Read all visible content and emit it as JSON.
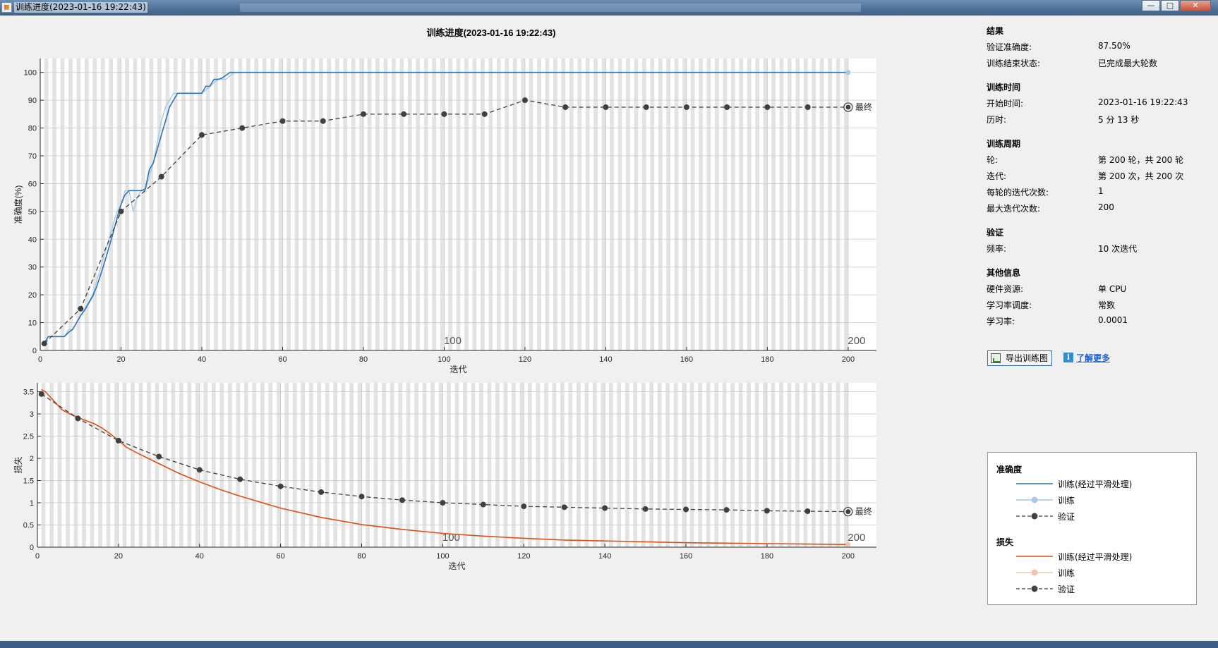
{
  "window": {
    "title": "训练进度(2023-01-16 19:22:43)",
    "btn_min": "—",
    "btn_max": "□",
    "btn_close": "✕"
  },
  "chart_title": "训练进度(2023-01-16 19:22:43)",
  "chart_data": [
    {
      "type": "line",
      "name": "accuracy",
      "xlabel": "迭代",
      "ylabel": "准确度(%)",
      "xlim": [
        0,
        200
      ],
      "ylim": [
        0,
        105
      ],
      "xticks": [
        0,
        20,
        40,
        60,
        80,
        100,
        120,
        140,
        160,
        180,
        200
      ],
      "yticks": [
        0,
        10,
        20,
        30,
        40,
        50,
        60,
        70,
        80,
        90,
        100
      ],
      "epoch_markers": [
        "100",
        "200"
      ],
      "grid": true,
      "colors": {
        "smooth": "#2f74b5",
        "raw": "#a9c9e6",
        "validation": "#404040"
      },
      "series": [
        {
          "name": "训练(经过平滑处理)",
          "x": [
            1,
            2,
            3,
            4,
            5,
            6,
            7,
            8,
            9,
            10,
            11,
            12,
            13,
            14,
            15,
            16,
            17,
            18,
            19,
            20,
            21,
            22,
            23,
            24,
            25,
            26,
            27,
            28,
            29,
            30,
            31,
            32,
            33,
            34,
            35,
            36,
            37,
            38,
            39,
            40,
            41,
            42,
            43,
            44,
            45,
            46,
            47,
            48,
            60,
            80,
            100,
            120,
            140,
            160,
            180,
            200
          ],
          "y": [
            2.5,
            5,
            5,
            5,
            5,
            5,
            6.5,
            7.5,
            10,
            12.5,
            14.5,
            17,
            19.5,
            23,
            27.5,
            32,
            37,
            42,
            47.5,
            52.5,
            56,
            57.5,
            57.5,
            57.5,
            57.5,
            58,
            65,
            67.5,
            72.5,
            77.5,
            82.5,
            87.5,
            90,
            92.5,
            92.5,
            92.5,
            92.5,
            92.5,
            92.5,
            92.5,
            95,
            95,
            97.5,
            97.5,
            98,
            99,
            100,
            100,
            100,
            100,
            100,
            100,
            100,
            100,
            100,
            100
          ]
        },
        {
          "name": "训练",
          "x": [
            1,
            2,
            3,
            4,
            5,
            6,
            7,
            8,
            9,
            10,
            11,
            12,
            13,
            14,
            15,
            16,
            17,
            18,
            19,
            20,
            21,
            22,
            23,
            24,
            25,
            26,
            27,
            28,
            29,
            30,
            31,
            32,
            33,
            34,
            35,
            36,
            37,
            38,
            39,
            40,
            42,
            44,
            46,
            48,
            60,
            80,
            100,
            120,
            140,
            160,
            180,
            200
          ],
          "y": [
            2.5,
            5,
            5,
            5,
            5,
            5,
            7.5,
            7.5,
            10,
            12.5,
            15,
            17.5,
            20,
            25,
            30,
            35,
            40,
            45,
            50,
            52.5,
            57.5,
            57.5,
            50,
            55,
            57.5,
            57.5,
            62.5,
            67.5,
            75,
            82.5,
            87.5,
            90,
            92.5,
            92.5,
            92.5,
            92.5,
            92.5,
            92.5,
            92.5,
            92.5,
            95,
            97.5,
            97.5,
            100,
            100,
            100,
            100,
            100,
            100,
            100,
            100,
            100
          ]
        },
        {
          "name": "验证",
          "x": [
            1,
            10,
            20,
            30,
            40,
            50,
            60,
            70,
            80,
            90,
            100,
            110,
            120,
            130,
            140,
            150,
            160,
            170,
            180,
            190,
            200
          ],
          "y": [
            2.5,
            15,
            50,
            62.5,
            77.5,
            80,
            82.5,
            82.5,
            85,
            85,
            85,
            85,
            90,
            87.5,
            87.5,
            87.5,
            87.5,
            87.5,
            87.5,
            87.5,
            87.5
          ]
        }
      ],
      "final_label": "最终"
    },
    {
      "type": "line",
      "name": "loss",
      "xlabel": "迭代",
      "ylabel": "损失",
      "xlim": [
        0,
        200
      ],
      "ylim": [
        0,
        3.7
      ],
      "xticks": [
        0,
        20,
        40,
        60,
        80,
        100,
        120,
        140,
        160,
        180,
        200
      ],
      "yticks": [
        0,
        0.5,
        1,
        1.5,
        2,
        2.5,
        3,
        3.5
      ],
      "epoch_markers": [
        "100",
        "200"
      ],
      "grid": true,
      "colors": {
        "smooth": "#d95319",
        "raw": "#f2c4ad",
        "validation": "#404040"
      },
      "series": [
        {
          "name": "训练(经过平滑处理)",
          "x": [
            1,
            2,
            3,
            4,
            5,
            6,
            8,
            10,
            12,
            14,
            16,
            18,
            20,
            22,
            24,
            26,
            28,
            30,
            35,
            40,
            45,
            50,
            60,
            70,
            80,
            90,
            100,
            110,
            120,
            130,
            140,
            150,
            160,
            170,
            180,
            190,
            200
          ],
          "y": [
            3.55,
            3.5,
            3.4,
            3.3,
            3.2,
            3.1,
            3.0,
            2.92,
            2.85,
            2.78,
            2.68,
            2.55,
            2.4,
            2.25,
            2.15,
            2.06,
            1.97,
            1.88,
            1.66,
            1.47,
            1.3,
            1.15,
            0.88,
            0.67,
            0.51,
            0.4,
            0.31,
            0.25,
            0.2,
            0.16,
            0.14,
            0.12,
            0.1,
            0.09,
            0.08,
            0.07,
            0.06
          ]
        },
        {
          "name": "训练",
          "x": [
            1,
            2,
            3,
            4,
            5,
            6,
            8,
            10,
            12,
            14,
            16,
            18,
            20,
            22,
            24,
            26,
            28,
            30,
            35,
            40,
            45,
            50,
            60,
            70,
            80,
            90,
            100,
            110,
            120,
            130,
            140,
            150,
            160,
            170,
            180,
            190,
            200
          ],
          "y": [
            3.55,
            3.5,
            3.4,
            3.3,
            3.2,
            3.1,
            3.0,
            2.92,
            2.85,
            2.78,
            2.68,
            2.55,
            2.4,
            2.25,
            2.15,
            2.06,
            1.97,
            1.88,
            1.66,
            1.47,
            1.3,
            1.15,
            0.88,
            0.67,
            0.51,
            0.4,
            0.31,
            0.25,
            0.2,
            0.16,
            0.14,
            0.12,
            0.1,
            0.09,
            0.08,
            0.07,
            0.06
          ]
        },
        {
          "name": "验证",
          "x": [
            1,
            10,
            20,
            30,
            40,
            50,
            60,
            70,
            80,
            90,
            100,
            110,
            120,
            130,
            140,
            150,
            160,
            170,
            180,
            190,
            200
          ],
          "y": [
            3.45,
            2.9,
            2.4,
            2.04,
            1.74,
            1.53,
            1.37,
            1.24,
            1.14,
            1.06,
            1.0,
            0.96,
            0.92,
            0.9,
            0.88,
            0.86,
            0.85,
            0.84,
            0.82,
            0.81,
            0.8
          ]
        }
      ],
      "final_label": "最终"
    }
  ],
  "panel": {
    "results_h": "结果",
    "val_acc_k": "验证准确度:",
    "val_acc_v": "87.50%",
    "end_state_k": "训练结束状态:",
    "end_state_v": "已完成最大轮数",
    "time_h": "训练时间",
    "start_k": "开始时间:",
    "start_v": "2023-01-16 19:22:43",
    "elapsed_k": "历时:",
    "elapsed_v": "5 分 13 秒",
    "cycle_h": "训练周期",
    "epoch_k": "轮:",
    "epoch_v": "第 200 轮，共 200 轮",
    "iter_k": "迭代:",
    "iter_v": "第 200 次，共 200 次",
    "iter_per_epoch_k": "每轮的迭代次数:",
    "iter_per_epoch_v": "1",
    "max_iter_k": "最大迭代次数:",
    "max_iter_v": "200",
    "val_h": "验证",
    "freq_k": "频率:",
    "freq_v": "10 次迭代",
    "other_h": "其他信息",
    "hw_k": "硬件资源:",
    "hw_v": "单 CPU",
    "lr_sched_k": "学习率调度:",
    "lr_sched_v": "常数",
    "lr_k": "学习率:",
    "lr_v": "0.0001",
    "export_label": "导出训练图",
    "learn_more": "了解更多",
    "info_glyph": "i"
  },
  "legend": {
    "acc_h": "准确度",
    "loss_h": "损失",
    "smooth": "训练(经过平滑处理)",
    "train": "训练",
    "val": "验证"
  }
}
